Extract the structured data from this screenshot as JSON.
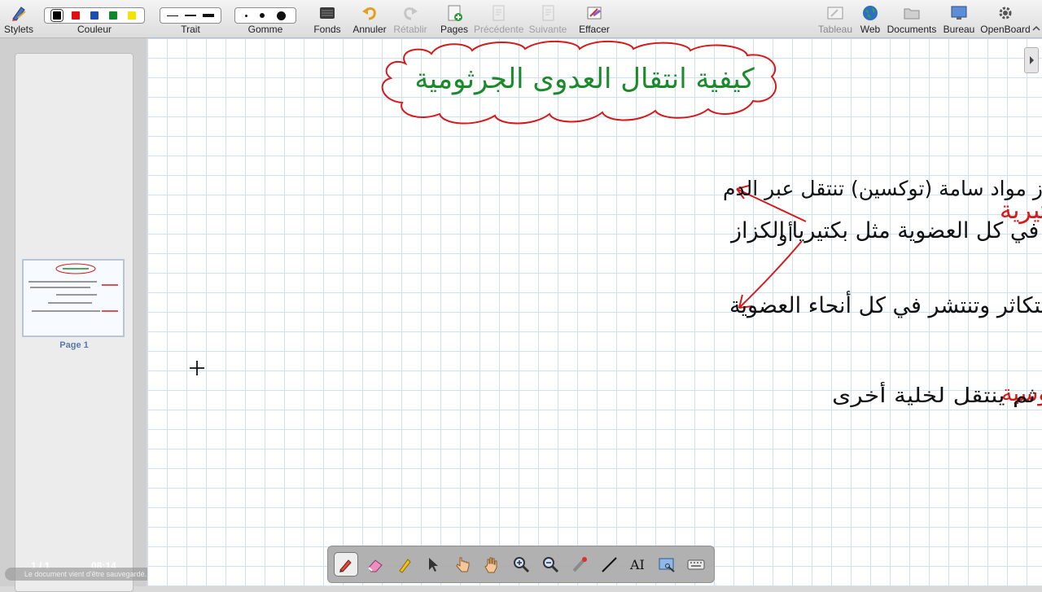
{
  "toolbar": {
    "stylets": "Stylets",
    "couleur": "Couleur",
    "trait": "Trait",
    "gomme": "Gomme",
    "fonds": "Fonds",
    "annuler": "Annuler",
    "retablir": "Rétablir",
    "pages": "Pages",
    "precedente": "Précédente",
    "suivante": "Suivante",
    "effacer": "Effacer",
    "tableau": "Tableau",
    "web": "Web",
    "documents": "Documents",
    "bureau": "Bureau",
    "openboard": "OpenBoard",
    "colors": [
      "#000000",
      "#e01010",
      "#1a4fb0",
      "#11882a",
      "#f5e200"
    ]
  },
  "thumbnails": {
    "page_label": "Page 1"
  },
  "status": {
    "page_count": "1 / 1",
    "clock": "08:14",
    "message": "Le document vient d'être sauvegardé."
  },
  "bottom_toolbar": {
    "tools": [
      "pen-tool",
      "eraser-tool",
      "highlighter-tool",
      "selector-tool",
      "pointer-hand-tool",
      "pan-hand-tool",
      "zoom-in-tool",
      "zoom-out-tool",
      "laser-pointer-tool",
      "line-tool",
      "text-tool",
      "capture-tool",
      "keyboard-tool"
    ],
    "text_tool_glyph": "AI"
  },
  "board": {
    "ink_colors": {
      "title": "#1a8a2a",
      "cloud": "#d41a1a",
      "black": "#111111",
      "red": "#d41a1a"
    },
    "handwriting": {
      "title": "كيفية انتقال العدوى الجرثومية",
      "bacterial_label": "العدوى البكتيرية",
      "line1": "تستقر في مكان الاصابة وتفرز مواد سامة (توكسين) تنتقل عبر الدم",
      "line2": "لتنتشر في كل العضوية مثل بكتيريا الكزاز",
      "or": "أو",
      "line3": "تتكاثر وتنتشر في كل أنحاء العضوية",
      "viral_label": "العدوى الفيروسية",
      "line4": "= الفيروس يهاجم خلية، يتكاثر داخلها ويخربها ثم ينتقل لخلية أخرى"
    }
  }
}
